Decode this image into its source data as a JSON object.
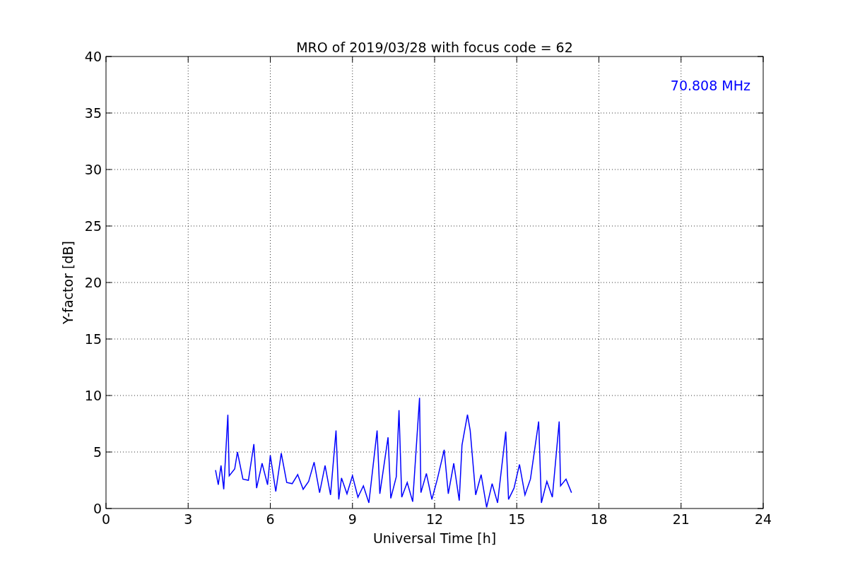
{
  "figure": {
    "chart_data": {
      "type": "line",
      "title": "MRO of 2019/03/28 with focus code = 62",
      "xlabel": "Universal Time [h]",
      "ylabel": "Y-factor [dB]",
      "x": [
        4.0,
        4.1,
        4.2,
        4.3,
        4.45,
        4.5,
        4.7,
        4.8,
        5.0,
        5.2,
        5.4,
        5.5,
        5.7,
        5.9,
        6.0,
        6.2,
        6.4,
        6.6,
        6.8,
        7.0,
        7.2,
        7.4,
        7.6,
        7.8,
        8.0,
        8.2,
        8.4,
        8.5,
        8.6,
        8.8,
        9.0,
        9.2,
        9.4,
        9.6,
        9.9,
        10.0,
        10.3,
        10.4,
        10.6,
        10.7,
        10.8,
        11.0,
        11.2,
        11.45,
        11.5,
        11.7,
        11.9,
        12.1,
        12.35,
        12.5,
        12.7,
        12.9,
        13.0,
        13.2,
        13.3,
        13.5,
        13.7,
        13.9,
        14.1,
        14.3,
        14.6,
        14.7,
        14.9,
        15.1,
        15.3,
        15.5,
        15.8,
        15.9,
        16.1,
        16.3,
        16.55,
        16.6,
        16.8,
        17.0
      ],
      "series": [
        {
          "name": "70.808 MHz",
          "color": "#0000ff",
          "values": [
            3.4,
            2.1,
            3.8,
            1.7,
            8.3,
            2.9,
            3.5,
            5.0,
            2.6,
            2.5,
            5.7,
            1.8,
            4.0,
            2.1,
            4.7,
            1.5,
            4.9,
            2.3,
            2.2,
            3.0,
            1.7,
            2.4,
            4.1,
            1.4,
            3.8,
            1.2,
            6.9,
            0.8,
            2.7,
            1.3,
            2.9,
            1.0,
            2.0,
            0.5,
            6.9,
            1.3,
            6.3,
            0.9,
            2.8,
            8.7,
            1.0,
            2.3,
            0.6,
            9.8,
            1.4,
            3.1,
            0.8,
            2.6,
            5.2,
            1.3,
            4.0,
            0.7,
            5.6,
            8.3,
            6.9,
            1.2,
            3.0,
            0.1,
            2.2,
            0.5,
            6.8,
            0.8,
            1.8,
            3.9,
            1.2,
            2.6,
            7.7,
            0.5,
            2.4,
            1.0,
            7.7,
            2.0,
            2.6,
            1.4
          ]
        }
      ],
      "grid": true,
      "xlim": [
        0,
        24
      ],
      "ylim": [
        0,
        40
      ],
      "xticks": [
        0,
        3,
        6,
        9,
        12,
        15,
        18,
        21,
        24
      ],
      "yticks": [
        0,
        5,
        10,
        15,
        20,
        25,
        30,
        35,
        40
      ]
    }
  }
}
